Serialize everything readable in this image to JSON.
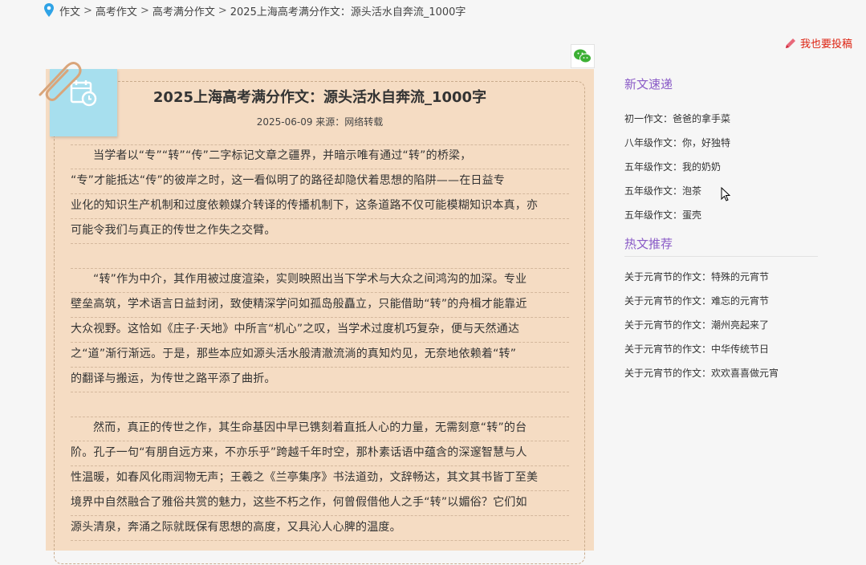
{
  "breadcrumb": {
    "items": [
      "作文",
      "高考作文",
      "高考满分作文",
      "2025上海高考满分作文：源头活水自奔流_1000字"
    ],
    "separator": ">"
  },
  "header": {
    "submit_label": "我也要投稿"
  },
  "article": {
    "title": "2025上海高考满分作文：源头活水自奔流_1000字",
    "meta": "2025-06-09 来源：网络转载",
    "paragraphs": [
      {
        "lines": [
          "当学者以“专”“转”“传”二字标记文章之疆界，并暗示唯有通过“转”的桥梁，",
          "“专”才能抵达“传”的彼岸之时，这一看似明了的路径却隐伏着思想的陷阱——在日益专",
          "业化的知识生产机制和过度依赖媒介转译的传播机制下，这条道路不仅可能模糊知识本真，亦",
          "可能令我们与真正的传世之作失之交臂。"
        ]
      },
      {
        "lines": [
          "“转”作为中介，其作用被过度渲染，实则映照出当下学术与大众之间鸿沟的加深。专业",
          "壁垒高筑，学术语言日益封闭，致使精深学问如孤岛般矗立，只能借助“转”的舟楫才能靠近",
          "大众视野。这恰如《庄子·天地》中所言“机心”之叹，当学术过度机巧复杂，便与天然通达",
          "之“道”渐行渐远。于是，那些本应如源头活水般清澈流淌的真知灼见，无奈地依赖着“转”",
          "的翻译与搬运，为传世之路平添了曲折。"
        ]
      },
      {
        "lines": [
          "然而，真正的传世之作，其生命基因中早已镌刻着直抵人心的力量，无需刻意“转”的台",
          "阶。孔子一句“有朋自远方来，不亦乐乎”跨越千年时空，那朴素话语中蕴含的深邃智慧与人",
          "性温暖，如春风化雨润物无声；王羲之《兰亭集序》书法道劲，文辞畅达，其文其书皆丁至美",
          "境界中自然融合了雅俗共赏的魅力，这些不朽之作，何曾假借他人之手“转”以媚俗？它们如",
          "源头清泉，奔涌之际就既保有思想的高度，又具沁人心脾的温度。"
        ]
      }
    ]
  },
  "sidebar": {
    "new_title": "新文速递",
    "new_items": [
      "初一作文：爸爸的拿手菜",
      "八年级作文：你，好独特",
      "五年级作文：我的奶奶",
      "五年级作文：泡茶",
      "五年级作文：蛋壳"
    ],
    "hot_title": "热文推荐",
    "hot_items": [
      "关于元宵节的作文：特殊的元宵节",
      "关于元宵节的作文：难忘的元宵节",
      "关于元宵节的作文：潮州亮起来了",
      "关于元宵节的作文：中华传统节日",
      "关于元宵节的作文：欢欢喜喜做元宵"
    ]
  },
  "colors": {
    "accent": "#8a5bc7",
    "submit": "#dd2211",
    "card": "#f5dcc3",
    "note": "#a7dfee"
  },
  "icons": [
    "location-pin-icon",
    "pencil-icon",
    "wechat-icon",
    "paperclip-icon",
    "calendar-clock-icon",
    "mouse-cursor-icon"
  ]
}
